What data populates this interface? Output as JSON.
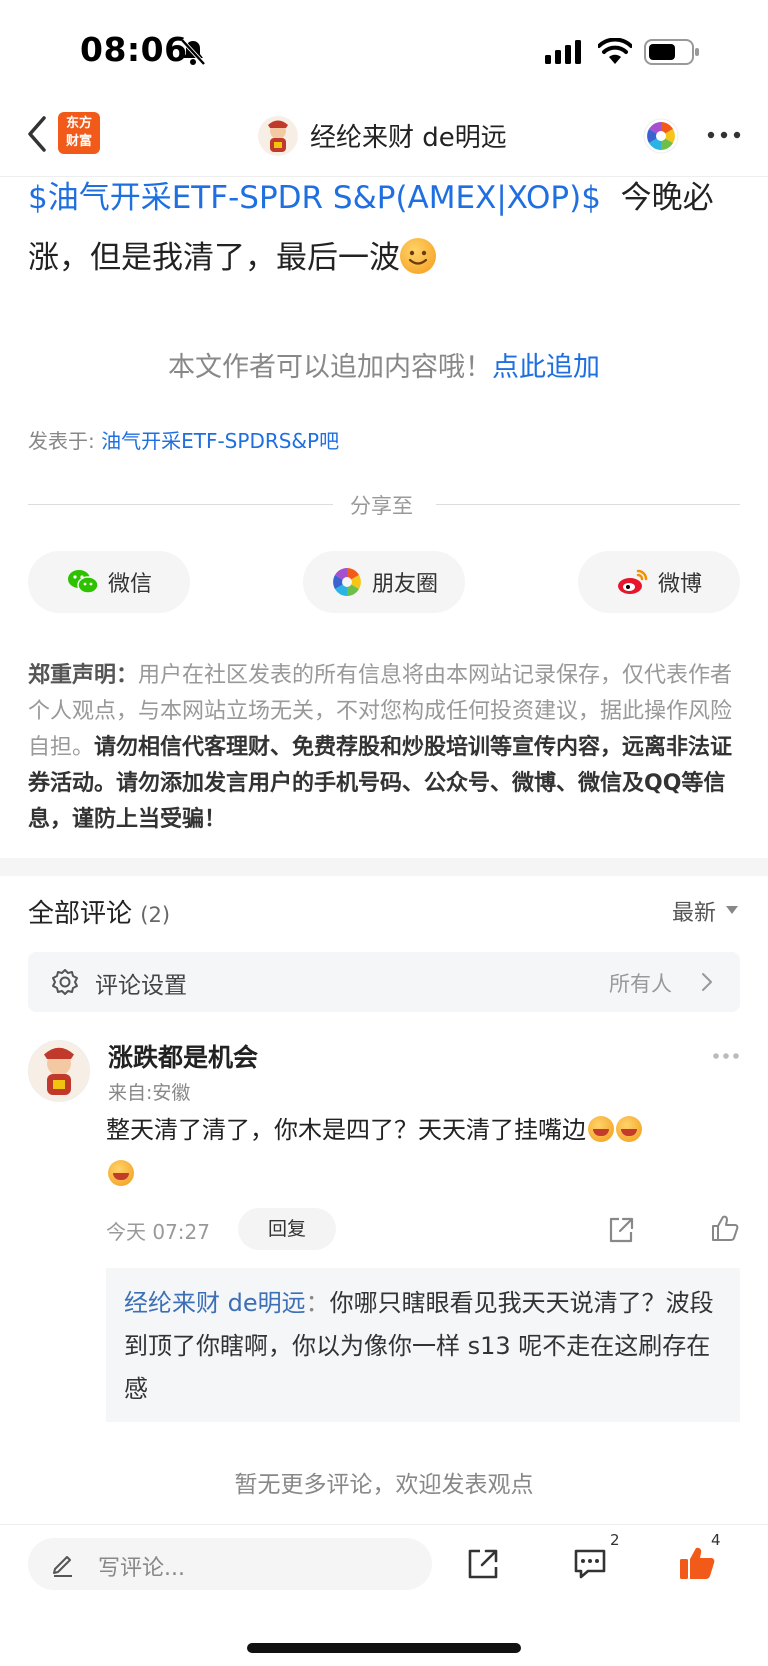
{
  "status_bar": {
    "time": "08:06"
  },
  "header": {
    "logo_line1": "东方",
    "logo_line2": "财富",
    "author_name": "经纶来财 de明远"
  },
  "post": {
    "stock_link": "$油气开采ETF-SPDR S&P(AMEX|XOP)$",
    "text_after_link": "今晚必涨，但是我清了，最后一波",
    "append_text": "本文作者可以追加内容哦！",
    "append_link": "点此追加",
    "posted_in_label": "发表于:",
    "posted_in_bar": "油气开采ETF-SPDRS&P吧"
  },
  "share": {
    "label": "分享至",
    "wechat": "微信",
    "moments": "朋友圈",
    "weibo": "微博"
  },
  "disclaimer": {
    "title": "郑重声明：",
    "body": "用户在社区发表的所有信息将由本网站记录保存，仅代表作者个人观点，与本网站立场无关，不对您构成任何投资建议，据此操作风险自担。",
    "bold": "请勿相信代客理财、免费荐股和炒股培训等宣传内容，远离非法证券活动。请勿添加发言用户的手机号码、公众号、微博、微信及QQ等信息，谨防上当受骗！"
  },
  "comments": {
    "title": "全部评论",
    "count": "(2)",
    "sort": "最新",
    "settings_label": "评论设置",
    "settings_value": "所有人",
    "items": [
      {
        "user": "涨跌都是机会",
        "location": "来自:安徽",
        "text": "整天清了清了，你木是四了？天天清了挂嘴边",
        "time": "今天 07:27",
        "reply_label": "回复",
        "sub_reply": {
          "user": "经纶来财 de明远",
          "colon": "：",
          "text": "你哪只瞎眼看见我天天说清了？波段到顶了你瞎啊，你以为像你一样 s13 呢不走在这刷存在感"
        }
      }
    ],
    "no_more": "暂无更多评论，欢迎发表观点"
  },
  "bottom_bar": {
    "write_placeholder": "写评论...",
    "comment_count": "2",
    "like_count": "4"
  },
  "colors": {
    "link_blue": "#1f6fe0",
    "brand_orange": "#f25a19",
    "like_orange": "#f25a19"
  }
}
